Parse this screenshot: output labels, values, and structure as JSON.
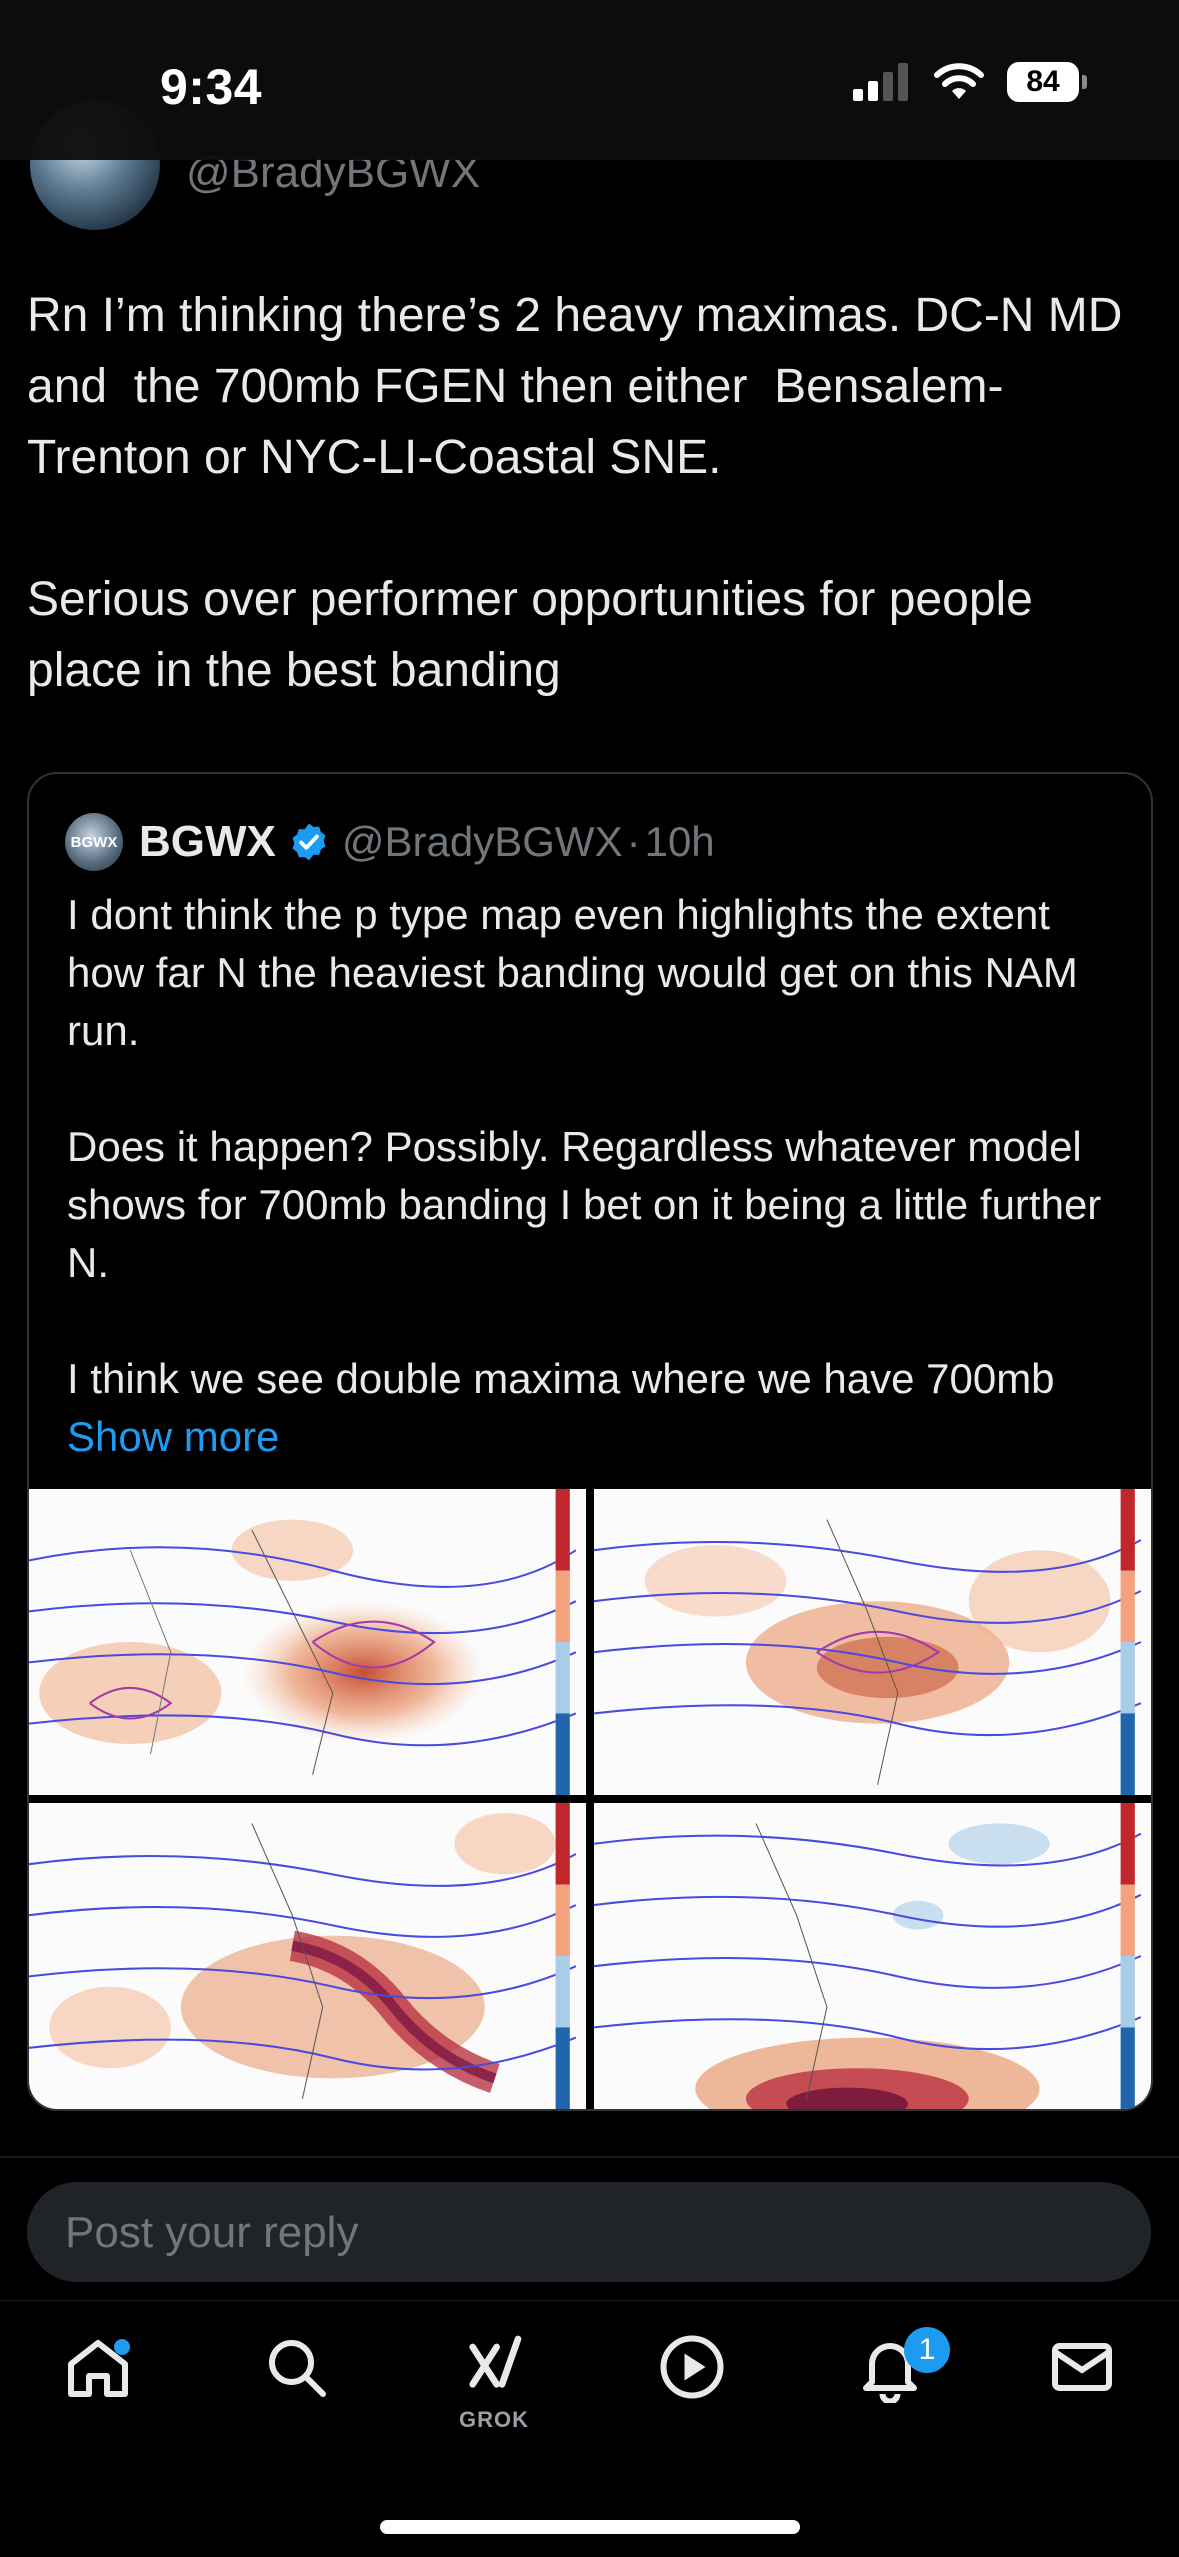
{
  "status": {
    "time": "9:34",
    "battery": "84"
  },
  "post": {
    "handle": "@BradyBGWX",
    "text": "Rn I’m thinking there’s 2 heavy maximas. DC-N MD and  the 700mb FGEN then either  Bensalem-Trenton or NYC-LI-Coastal SNE.\n\nSerious over performer opportunities for people place in the best banding"
  },
  "quote": {
    "avatar_text": "BGWX",
    "name": "BGWX",
    "handle": "@BradyBGWX",
    "separator": "·",
    "time": "10h",
    "text": "I dont think the p type map even highlights the extent how far N the heaviest banding would get on this NAM run.\n\nDoes it happen? Possibly. Regardless whatever model shows for 700mb banding I bet on it being a little further N.\n\nI think we see double maxima where we have 700mb ",
    "show_more": "Show more"
  },
  "reply": {
    "placeholder": "Post your reply"
  },
  "tabs": {
    "grok_label": "GROK",
    "notifications_count": "1"
  },
  "colors": {
    "accent": "#1d9bf0",
    "background": "#000000",
    "muted": "#71767b"
  }
}
